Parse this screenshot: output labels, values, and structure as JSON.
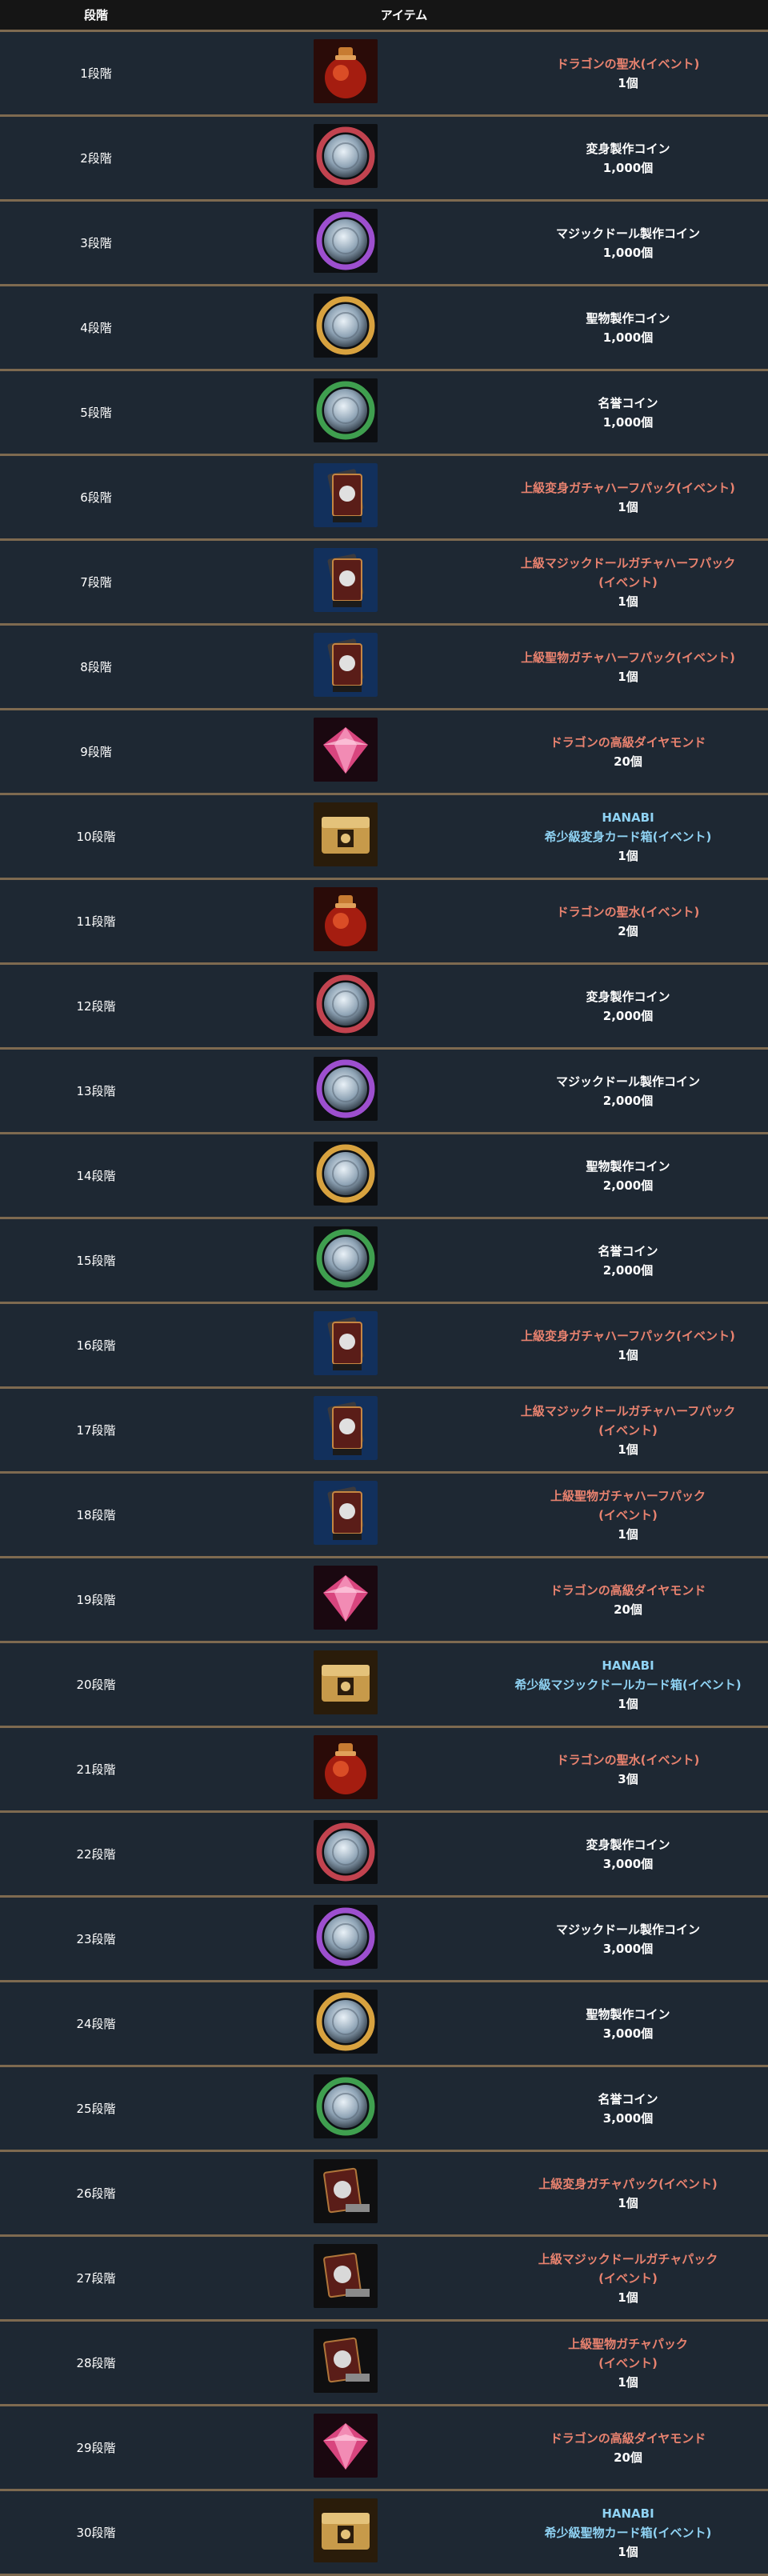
{
  "header": {
    "stage": "段階",
    "item": "アイテム"
  },
  "rows": [
    {
      "stage": "1段階",
      "icon": "dragon-holy-water-icon",
      "lines": [
        "ドラゴンの聖水(イベント)"
      ],
      "color": "red",
      "qty": "1個"
    },
    {
      "stage": "2段階",
      "icon": "transform-coin-icon",
      "lines": [
        "変身製作コイン"
      ],
      "color": "white",
      "qty": "1,000個"
    },
    {
      "stage": "3段階",
      "icon": "magic-doll-coin-icon",
      "lines": [
        "マジックドール製作コイン"
      ],
      "color": "white",
      "qty": "1,000個"
    },
    {
      "stage": "4段階",
      "icon": "holy-item-coin-icon",
      "lines": [
        "聖物製作コイン"
      ],
      "color": "white",
      "qty": "1,000個"
    },
    {
      "stage": "5段階",
      "icon": "honor-coin-icon",
      "lines": [
        "名誉コイン"
      ],
      "color": "white",
      "qty": "1,000個"
    },
    {
      "stage": "6段階",
      "icon": "card-pack-icon",
      "lines": [
        "上級変身ガチャハーフパック(イベント)"
      ],
      "color": "red",
      "qty": "1個"
    },
    {
      "stage": "7段階",
      "icon": "card-pack-icon",
      "lines": [
        "上級マジックドールガチャハーフパック",
        "(イベント)"
      ],
      "color": "red",
      "qty": "1個"
    },
    {
      "stage": "8段階",
      "icon": "card-pack-icon",
      "lines": [
        "上級聖物ガチャハーフパック(イベント)"
      ],
      "color": "red",
      "qty": "1個"
    },
    {
      "stage": "9段階",
      "icon": "dragon-diamond-icon",
      "lines": [
        "ドラゴンの高級ダイヤモンド"
      ],
      "color": "red",
      "qty": "20個"
    },
    {
      "stage": "10段階",
      "icon": "card-box-icon",
      "lines": [
        "HANABI",
        "希少級変身カード箱(イベント)"
      ],
      "color": "blue",
      "qty": "1個"
    },
    {
      "stage": "11段階",
      "icon": "dragon-holy-water-icon",
      "lines": [
        "ドラゴンの聖水(イベント)"
      ],
      "color": "red",
      "qty": "2個"
    },
    {
      "stage": "12段階",
      "icon": "transform-coin-icon",
      "lines": [
        "変身製作コイン"
      ],
      "color": "white",
      "qty": "2,000個"
    },
    {
      "stage": "13段階",
      "icon": "magic-doll-coin-icon",
      "lines": [
        "マジックドール製作コイン"
      ],
      "color": "white",
      "qty": "2,000個"
    },
    {
      "stage": "14段階",
      "icon": "holy-item-coin-icon",
      "lines": [
        "聖物製作コイン"
      ],
      "color": "white",
      "qty": "2,000個"
    },
    {
      "stage": "15段階",
      "icon": "honor-coin-icon",
      "lines": [
        "名誉コイン"
      ],
      "color": "white",
      "qty": "2,000個"
    },
    {
      "stage": "16段階",
      "icon": "card-pack-icon",
      "lines": [
        "上級変身ガチャハーフパック(イベント)"
      ],
      "color": "red",
      "qty": "1個"
    },
    {
      "stage": "17段階",
      "icon": "card-pack-icon",
      "lines": [
        "上級マジックドールガチャハーフパック",
        "(イベント)"
      ],
      "color": "red",
      "qty": "1個"
    },
    {
      "stage": "18段階",
      "icon": "card-pack-icon",
      "lines": [
        "上級聖物ガチャハーフパック",
        "(イベント)"
      ],
      "color": "red",
      "qty": "1個"
    },
    {
      "stage": "19段階",
      "icon": "dragon-diamond-icon",
      "lines": [
        "ドラゴンの高級ダイヤモンド"
      ],
      "color": "red",
      "qty": "20個"
    },
    {
      "stage": "20段階",
      "icon": "card-box-icon",
      "lines": [
        "HANABI",
        "希少級マジックドールカード箱(イベント)"
      ],
      "color": "blue",
      "qty": "1個"
    },
    {
      "stage": "21段階",
      "icon": "dragon-holy-water-icon",
      "lines": [
        "ドラゴンの聖水(イベント)"
      ],
      "color": "red",
      "qty": "3個"
    },
    {
      "stage": "22段階",
      "icon": "transform-coin-icon",
      "lines": [
        "変身製作コイン"
      ],
      "color": "white",
      "qty": "3,000個"
    },
    {
      "stage": "23段階",
      "icon": "magic-doll-coin-icon",
      "lines": [
        "マジックドール製作コイン"
      ],
      "color": "white",
      "qty": "3,000個"
    },
    {
      "stage": "24段階",
      "icon": "holy-item-coin-icon",
      "lines": [
        "聖物製作コイン"
      ],
      "color": "white",
      "qty": "3,000個"
    },
    {
      "stage": "25段階",
      "icon": "honor-coin-icon",
      "lines": [
        "名誉コイン"
      ],
      "color": "white",
      "qty": "3,000個"
    },
    {
      "stage": "26段階",
      "icon": "gacha-pack-icon",
      "lines": [
        "上級変身ガチャパック(イベント)"
      ],
      "color": "red",
      "qty": "1個"
    },
    {
      "stage": "27段階",
      "icon": "gacha-pack-icon",
      "lines": [
        "上級マジックドールガチャパック",
        "(イベント)"
      ],
      "color": "red",
      "qty": "1個"
    },
    {
      "stage": "28段階",
      "icon": "gacha-pack-icon",
      "lines": [
        "上級聖物ガチャパック",
        "(イベント)"
      ],
      "color": "red",
      "qty": "1個"
    },
    {
      "stage": "29段階",
      "icon": "dragon-diamond-icon",
      "lines": [
        "ドラゴンの高級ダイヤモンド"
      ],
      "color": "red",
      "qty": "20個"
    },
    {
      "stage": "30段階",
      "icon": "card-box-icon",
      "lines": [
        "HANABI",
        "希少級聖物カード箱(イベント)"
      ],
      "color": "blue",
      "qty": "1個"
    }
  ],
  "colors": {
    "background": "#1e2833",
    "header_background": "#151515",
    "divider": "#7e6a50",
    "event_text": "#e8826f",
    "hanabi_text": "#8fd2f3"
  }
}
